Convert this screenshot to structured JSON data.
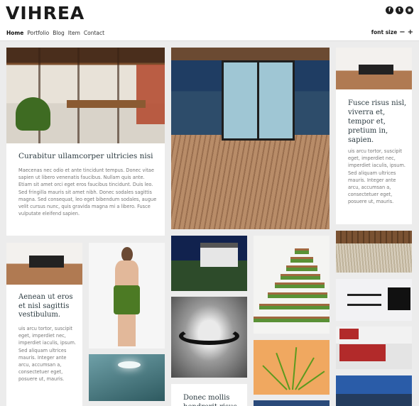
{
  "header": {
    "logo": "VIHREA",
    "nav": [
      {
        "label": "Home",
        "active": true
      },
      {
        "label": "Portfolio",
        "active": false
      },
      {
        "label": "Blog",
        "active": false
      },
      {
        "label": "Item",
        "active": false
      },
      {
        "label": "Contact",
        "active": false
      }
    ],
    "font_size_label": "font size",
    "font_minus": "−",
    "font_plus": "+",
    "social_icons": [
      "facebook-icon",
      "twitter-icon",
      "rss-icon"
    ]
  },
  "posts": [
    {
      "title": "Curabitur ullamcorper ultricies nisi",
      "excerpt": "Maecenas nec odio et ante tincidunt tempus. Donec vitae sapien ut libero venenatis faucibus. Nullam quis ante. Etiam sit amet orci eget eros faucibus tincidunt. Duis leo. Sed fringilla mauris sit amet nibh. Donec sodales sagittis magna. Sed consequat, leo eget bibendum sodales, augue velit cursus nunc, quis gravida magna mi a libero. Fusce vulputate eleifend sapien."
    },
    {
      "title": "Fusce risus nisl, viverra et, tempor et, pretium in, sapien.",
      "excerpt": "uis arcu tortor, suscipit eget, imperdiet nec, imperdiet iaculis, ipsum. Sed aliquam ultrices mauris. Integer ante arcu, accumsan a, consectetuer eget, posuere ut, mauris."
    },
    {
      "title": "Aenean ut eros et nisl sagittis vestibulum.",
      "excerpt": "uis arcu tortor, suscipit eget, imperdiet nec, imperdiet iaculis, ipsum. Sed aliquam ultrices mauris. Integer ante arcu, accumsan a, consectetuer eget, posuere ut, mauris."
    },
    {
      "title": "Donec mollis hendrerit risus",
      "excerpt": ""
    }
  ]
}
